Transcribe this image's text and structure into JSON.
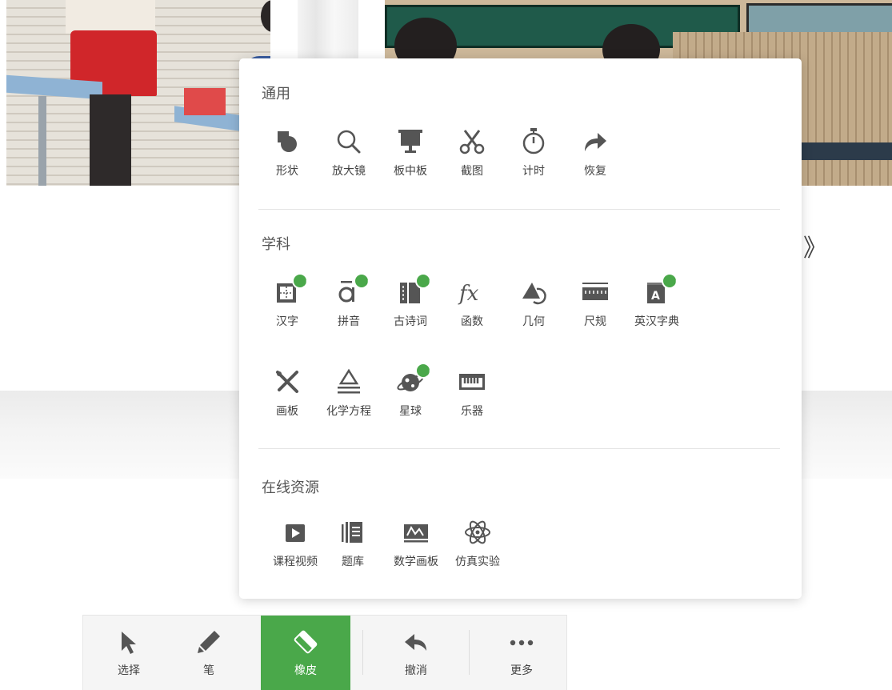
{
  "panel": {
    "sections": [
      {
        "title": "通用",
        "tools": [
          {
            "label": "形状",
            "icon": "shape-icon"
          },
          {
            "label": "放大镜",
            "icon": "magnifier-icon"
          },
          {
            "label": "板中板",
            "icon": "board-in-board-icon"
          },
          {
            "label": "截图",
            "icon": "scissors-icon"
          },
          {
            "label": "计时",
            "icon": "stopwatch-icon"
          },
          {
            "label": "恢复",
            "icon": "restore-arrow-icon"
          }
        ]
      },
      {
        "title": "学科",
        "tools": [
          {
            "label": "汉字",
            "icon": "hanzi-grid-icon",
            "download": true
          },
          {
            "label": "拼音",
            "icon": "pinyin-icon",
            "download": true
          },
          {
            "label": "古诗词",
            "icon": "poetry-book-icon",
            "download": true
          },
          {
            "label": "函数",
            "icon": "function-fx-icon"
          },
          {
            "label": "几何",
            "icon": "geometry-icon"
          },
          {
            "label": "尺规",
            "icon": "ruler-icon"
          },
          {
            "label": "英汉字典",
            "icon": "dictionary-icon",
            "download": true
          },
          {
            "label": "画板",
            "icon": "drawing-board-icon"
          },
          {
            "label": "化学方程",
            "icon": "chemistry-equation-icon"
          },
          {
            "label": "星球",
            "icon": "planet-icon",
            "download": true
          },
          {
            "label": "乐器",
            "icon": "piano-keyboard-icon"
          }
        ]
      },
      {
        "title": "在线资源",
        "tools": [
          {
            "label": "课程视频",
            "icon": "video-play-icon"
          },
          {
            "label": "题库",
            "icon": "question-bank-icon"
          },
          {
            "label": "数学画板",
            "icon": "math-board-icon"
          },
          {
            "label": "仿真实验",
            "icon": "atom-icon"
          }
        ]
      }
    ]
  },
  "toolbar": {
    "buttons": [
      {
        "label": "选择",
        "icon": "cursor-arrow-icon",
        "active": false
      },
      {
        "label": "笔",
        "icon": "pen-icon",
        "active": false
      },
      {
        "label": "橡皮",
        "icon": "eraser-icon",
        "active": true
      },
      {
        "label": "撤消",
        "icon": "undo-icon",
        "active": false
      },
      {
        "label": "更多",
        "icon": "more-dots-icon",
        "active": false
      }
    ]
  },
  "nav": {
    "next_glyph": "》",
    "next_icon": "chevron-right-icon"
  },
  "colors": {
    "accent": "#4aa84a",
    "icon": "#555555",
    "text": "#444444",
    "panel_bg": "#ffffff"
  }
}
